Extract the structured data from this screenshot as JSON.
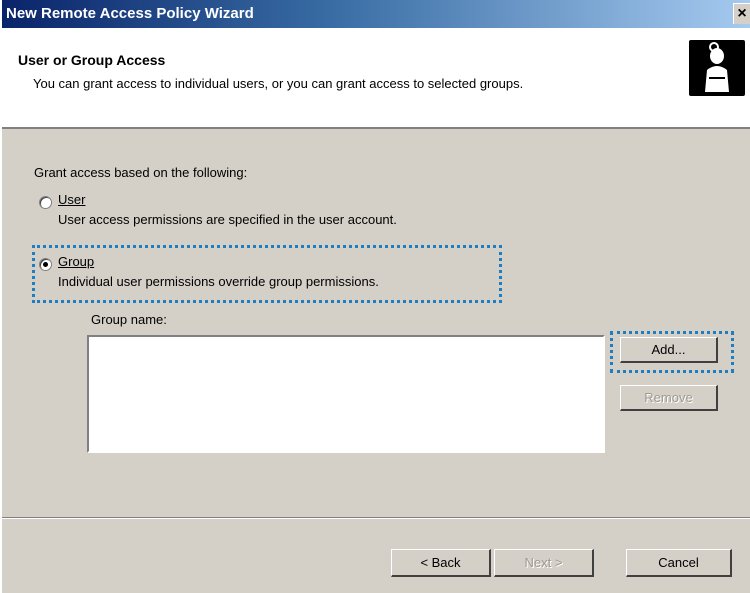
{
  "window": {
    "title": "New Remote Access Policy Wizard",
    "close_glyph": "×"
  },
  "header": {
    "title": "User or Group Access",
    "subtitle": "You can grant access to individual users, or you can grant access to selected groups.",
    "icon": "user-key-icon"
  },
  "content": {
    "prompt": "Grant access based on the following:",
    "options": [
      {
        "label": "User",
        "description": "User access permissions are specified in the user account.",
        "selected": false
      },
      {
        "label": "Group",
        "description": "Individual user permissions override group permissions.",
        "selected": true
      }
    ],
    "group_name_label": "Group name:",
    "group_list": []
  },
  "buttons": {
    "add": "Add...",
    "remove": "Remove",
    "back": "< Back",
    "next": "Next >",
    "cancel": "Cancel"
  },
  "colors": {
    "title_bar": "#0a246a",
    "focus_highlight": "#1f7ec2",
    "dialog_bg": "#d4d0c8"
  }
}
